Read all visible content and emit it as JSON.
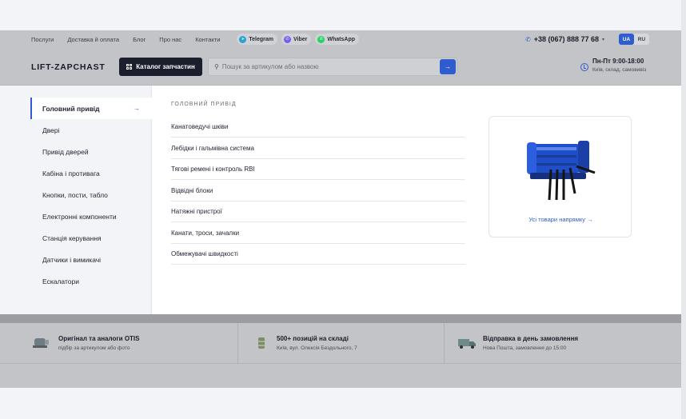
{
  "topbar": {
    "nav": [
      "Послуги",
      "Доставка й оплата",
      "Блог",
      "Про нас",
      "Контакти"
    ],
    "messengers": [
      {
        "label": "Telegram",
        "icon": "telegram-icon",
        "color": "#2a9fd8"
      },
      {
        "label": "Viber",
        "icon": "viber-icon",
        "color": "#7360f2"
      },
      {
        "label": "WhatsApp",
        "icon": "whatsapp-icon",
        "color": "#25d366"
      }
    ],
    "phone": "+38 (067) 888 77 68",
    "languages": [
      "UA",
      "RU"
    ],
    "active_language": "UA"
  },
  "header": {
    "logo": "LIFT-ZAPCHAST",
    "catalog_button": "Каталог запчастин",
    "search_placeholder": "Пошук за артикулом або назвою",
    "hours_title": "Пн-Пт 9:00-18:00",
    "hours_sub": "Київ, склад, самовивіз"
  },
  "menu": {
    "categories": [
      "Головний привід",
      "Двері",
      "Привід дверей",
      "Кабіна і противага",
      "Кнопки, пости, табло",
      "Електронні компоненти",
      "Станція керування",
      "Датчики і вимикачі",
      "Ескалатори"
    ],
    "active_category": "Головний привід",
    "section_title": "ГОЛОВНИЙ ПРИВІД",
    "subcategories": [
      "Канатоведучі шківи",
      "Лебідки і гальмівна система",
      "Тягові ремені і контроль RBI",
      "Відвідні блоки",
      "Натяжні пристрої",
      "Канати, троси, зачалки",
      "Обмежувачі швидкості"
    ],
    "card_link": "Усі товари напрямку"
  },
  "features": [
    {
      "title": "Оригінал та аналоги OTIS",
      "sub": "підбір за артикулом або фото",
      "icon": "motor-icon"
    },
    {
      "title": "500+ позицій на складі",
      "sub": "Київ, вул. Олексія Бездольного, 7",
      "icon": "warehouse-icon"
    },
    {
      "title": "Відправка в день замовлення",
      "sub": "Нова Пошта, замовлення до 15:00",
      "icon": "truck-icon"
    }
  ],
  "colors": {
    "accent": "#2f5ccf",
    "dark": "#1b1f2d"
  }
}
